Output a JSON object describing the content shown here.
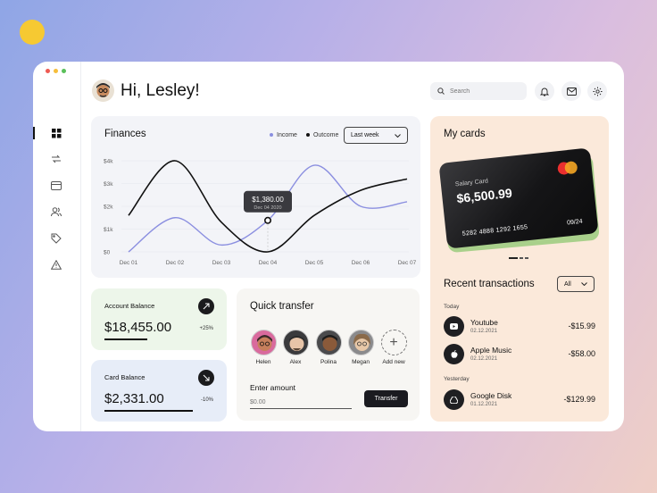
{
  "greeting": "Hi, Lesley!",
  "search": {
    "placeholder": "Search"
  },
  "finances": {
    "title": "Finances",
    "legend": {
      "income": "Income",
      "outcome": "Outcome"
    },
    "period": "Last week",
    "y_ticks": [
      "$4k",
      "$3k",
      "$2k",
      "$1k",
      "$0"
    ],
    "x_ticks": [
      "Dec 01",
      "Dec 02",
      "Dec 03",
      "Dec 04",
      "Dec 05",
      "Dec 06",
      "Dec 07"
    ],
    "tooltip": {
      "value": "$1,380.00",
      "date": "Dec 04 2020"
    }
  },
  "chart_data": {
    "type": "line",
    "x": [
      "Dec 01",
      "Dec 02",
      "Dec 03",
      "Dec 04",
      "Dec 05",
      "Dec 06",
      "Dec 07"
    ],
    "ylim": [
      0,
      4000
    ],
    "series": [
      {
        "name": "Income",
        "values": [
          0,
          1500,
          300,
          1380,
          3800,
          2000,
          2200
        ]
      },
      {
        "name": "Outcome",
        "values": [
          1600,
          4000,
          1300,
          0,
          1600,
          2700,
          3200
        ]
      }
    ]
  },
  "account_balance": {
    "title": "Account Balance",
    "value": "$18,455.00",
    "change": "+25%",
    "progress": 0.6
  },
  "card_balance": {
    "title": "Card Balance",
    "value": "$2,331.00",
    "change": "-10%",
    "progress": 0.85
  },
  "quick_transfer": {
    "title": "Quick transfer",
    "contacts": [
      "Helen",
      "Alex",
      "Polina",
      "Megan"
    ],
    "add_label": "Add new",
    "amount_label": "Enter amount",
    "amount_placeholder": "$0.00",
    "button": "Transfer"
  },
  "my_cards": {
    "title": "My cards",
    "card": {
      "label": "Salary Card",
      "balance": "$6,500.99",
      "number": "5282 4888 1292 1655",
      "expiry": "09/24"
    }
  },
  "transactions": {
    "title": "Recent transactions",
    "filter": "All",
    "groups": [
      {
        "day": "Today",
        "items": [
          {
            "name": "Youtube",
            "date": "02.12.2021",
            "amount": "-$15.99",
            "icon": "youtube-icon"
          },
          {
            "name": "Apple Music",
            "date": "02.12.2021",
            "amount": "-$58.00",
            "icon": "apple-icon"
          }
        ]
      },
      {
        "day": "Yesterday",
        "items": [
          {
            "name": "Google Disk",
            "date": "01.12.2021",
            "amount": "-$129.99",
            "icon": "google-drive-icon"
          }
        ]
      }
    ]
  },
  "colors": {
    "income": "#8b8fe0",
    "outcome": "#111111",
    "finances_bg": "#f3f4f8",
    "cards_bg": "#fbe9da",
    "account_bg": "#edf6ea",
    "cardbal_bg": "#e7edf8"
  }
}
